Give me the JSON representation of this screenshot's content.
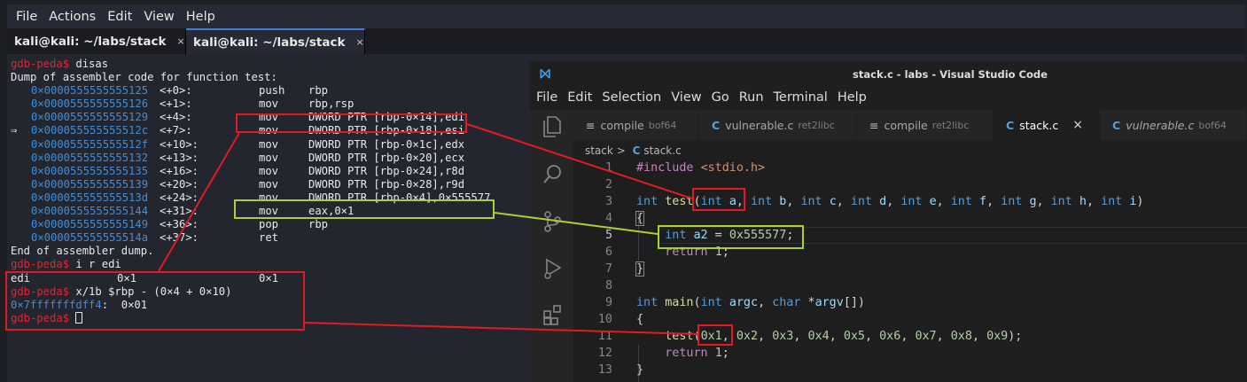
{
  "terminal": {
    "menu": [
      "File",
      "Actions",
      "Edit",
      "View",
      "Help"
    ],
    "tabs": [
      {
        "title": "kali@kali: ~/labs/stack",
        "close": "×"
      },
      {
        "title": "kali@kali: ~/labs/stack",
        "close": "×"
      }
    ],
    "lines": {
      "l0_prompt": "gdb-peda$",
      "l0_cmd": " disas",
      "l1": "Dump of assembler code for function test:",
      "asm": [
        {
          "pre": "",
          "addr": "0×0000555555555125",
          "off": "<+0>:",
          "mn": "push",
          "ops": "rbp"
        },
        {
          "pre": "",
          "addr": "0×0000555555555126",
          "off": "<+1>:",
          "mn": "mov",
          "ops": "rbp,rsp"
        },
        {
          "pre": "",
          "addr": "0×0000555555555129",
          "off": "<+4>:",
          "mn": "mov",
          "ops": "DWORD PTR [rbp-0×14],edi"
        },
        {
          "pre": "⇒",
          "addr": "0×000055555555512c",
          "off": "<+7>:",
          "mn": "mov",
          "ops": "DWORD PTR [rbp-0×18],esi"
        },
        {
          "pre": "",
          "addr": "0×000055555555512f",
          "off": "<+10>:",
          "mn": "mov",
          "ops": "DWORD PTR [rbp-0×1c],edx"
        },
        {
          "pre": "",
          "addr": "0×0000555555555132",
          "off": "<+13>:",
          "mn": "mov",
          "ops": "DWORD PTR [rbp-0×20],ecx"
        },
        {
          "pre": "",
          "addr": "0×0000555555555135",
          "off": "<+16>:",
          "mn": "mov",
          "ops": "DWORD PTR [rbp-0×24],r8d"
        },
        {
          "pre": "",
          "addr": "0×0000555555555139",
          "off": "<+20>:",
          "mn": "mov",
          "ops": "DWORD PTR [rbp-0×28],r9d"
        },
        {
          "pre": "",
          "addr": "0×000055555555513d",
          "off": "<+24>:",
          "mn": "mov",
          "ops": "DWORD PTR [rbp-0×4],0×555577"
        },
        {
          "pre": "",
          "addr": "0×0000555555555144",
          "off": "<+31>:",
          "mn": "mov",
          "ops": "eax,0×1"
        },
        {
          "pre": "",
          "addr": "0×0000555555555149",
          "off": "<+36>:",
          "mn": "pop",
          "ops": "rbp"
        },
        {
          "pre": "",
          "addr": "0×000055555555514a",
          "off": "<+37>:",
          "mn": "ret",
          "ops": ""
        }
      ],
      "end": "End of assembler dump.",
      "l_ir_prompt": "gdb-peda$",
      "l_ir_cmd": " i r edi",
      "reg_name": "edi",
      "reg_hex": "0×1",
      "reg_dec": "0×1",
      "l_x_prompt": "gdb-peda$",
      "l_x_cmd": " x/1b $rbp - (0×4 + 0×10)",
      "mem_addr": "0×7fffffffdff4",
      "mem_val": ":  0×01",
      "last_prompt": "gdb-peda$"
    }
  },
  "vscode": {
    "title": "stack.c - labs - Visual Studio Code",
    "menu": [
      "File",
      "Edit",
      "Selection",
      "View",
      "Go",
      "Run",
      "Terminal",
      "Help"
    ],
    "tabs": [
      {
        "icon": "≡",
        "name": "compile",
        "sub": "bof64"
      },
      {
        "icon": "C",
        "name": "vulnerable.c",
        "sub": "ret2libc"
      },
      {
        "icon": "≡",
        "name": "compile",
        "sub": "ret2libc"
      },
      {
        "icon": "C",
        "name": "stack.c",
        "sub": "",
        "close": "×"
      },
      {
        "icon": "C",
        "name": "vulnerable.c",
        "sub": "bof64"
      }
    ],
    "breadcrumb": {
      "folder": "stack",
      "sep": ">",
      "icon": "C",
      "file": "stack.c"
    },
    "line_numbers": [
      "1",
      "2",
      "3",
      "4",
      "5",
      "6",
      "7",
      "8",
      "9",
      "10",
      "11",
      "12",
      "13"
    ],
    "current_line": 5
  },
  "colors": {
    "annotation_red": "#e01b24",
    "annotation_green": "#a8d22f",
    "prompt": "#e4242f",
    "address": "#3f8edb"
  }
}
